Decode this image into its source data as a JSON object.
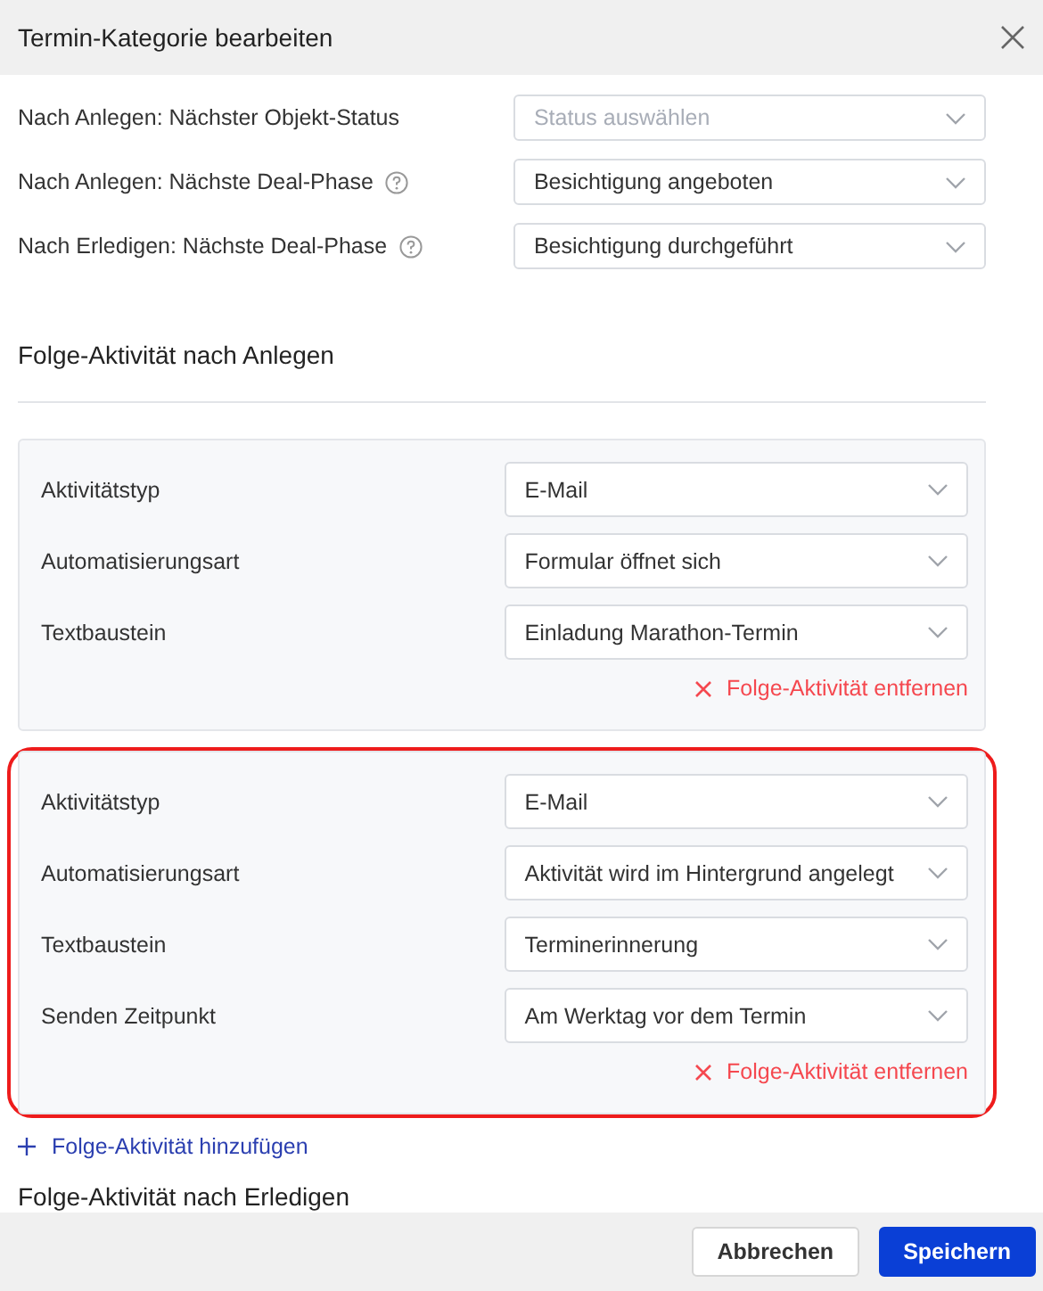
{
  "window": {
    "title": "Termin-Kategorie bearbeiten"
  },
  "settings": [
    {
      "label": "Nach Anlegen: Nächster Objekt-Status",
      "help": false,
      "placeholder": "Status auswählen"
    },
    {
      "label": "Nach Anlegen: Nächste Deal-Phase",
      "help": true,
      "value": "Besichtigung angeboten"
    },
    {
      "label": "Nach Erledigen: Nächste Deal-Phase",
      "help": true,
      "value": "Besichtigung durchgeführt"
    }
  ],
  "section_title": "Folge-Aktivität nach Anlegen",
  "activities": [
    {
      "highlighted": false,
      "fields": [
        {
          "label": "Aktivitätstyp",
          "value": "E-Mail"
        },
        {
          "label": "Automatisierungsart",
          "value": "Formular öffnet sich"
        },
        {
          "label": "Textbaustein",
          "value": "Einladung Marathon-Termin"
        }
      ],
      "remove_label": "Folge-Aktivität entfernen"
    },
    {
      "highlighted": true,
      "fields": [
        {
          "label": "Aktivitätstyp",
          "value": "E-Mail"
        },
        {
          "label": "Automatisierungsart",
          "value": "Aktivität wird im Hintergrund angelegt"
        },
        {
          "label": "Textbaustein",
          "value": "Terminerinnerung"
        },
        {
          "label": "Senden Zeitpunkt",
          "value": "Am Werktag vor dem Termin"
        }
      ],
      "remove_label": "Folge-Aktivität entfernen"
    }
  ],
  "add_label": "Folge-Aktivität hinzufügen",
  "next_section_title": "Folge-Aktivität nach Erledigen",
  "buttons": [
    {
      "label": "Abbrechen",
      "kind": "secondary"
    },
    {
      "label": "Speichern",
      "kind": "primary"
    }
  ]
}
